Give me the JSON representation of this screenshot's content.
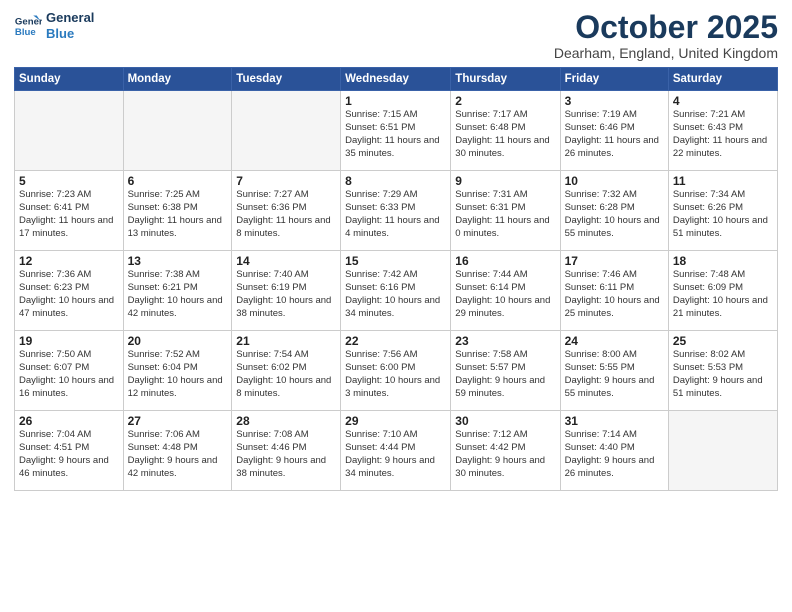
{
  "logo": {
    "line1": "General",
    "line2": "Blue"
  },
  "title": "October 2025",
  "location": "Dearham, England, United Kingdom",
  "weekdays": [
    "Sunday",
    "Monday",
    "Tuesday",
    "Wednesday",
    "Thursday",
    "Friday",
    "Saturday"
  ],
  "weeks": [
    [
      {
        "day": "",
        "info": ""
      },
      {
        "day": "",
        "info": ""
      },
      {
        "day": "",
        "info": ""
      },
      {
        "day": "1",
        "info": "Sunrise: 7:15 AM\nSunset: 6:51 PM\nDaylight: 11 hours\nand 35 minutes."
      },
      {
        "day": "2",
        "info": "Sunrise: 7:17 AM\nSunset: 6:48 PM\nDaylight: 11 hours\nand 30 minutes."
      },
      {
        "day": "3",
        "info": "Sunrise: 7:19 AM\nSunset: 6:46 PM\nDaylight: 11 hours\nand 26 minutes."
      },
      {
        "day": "4",
        "info": "Sunrise: 7:21 AM\nSunset: 6:43 PM\nDaylight: 11 hours\nand 22 minutes."
      }
    ],
    [
      {
        "day": "5",
        "info": "Sunrise: 7:23 AM\nSunset: 6:41 PM\nDaylight: 11 hours\nand 17 minutes."
      },
      {
        "day": "6",
        "info": "Sunrise: 7:25 AM\nSunset: 6:38 PM\nDaylight: 11 hours\nand 13 minutes."
      },
      {
        "day": "7",
        "info": "Sunrise: 7:27 AM\nSunset: 6:36 PM\nDaylight: 11 hours\nand 8 minutes."
      },
      {
        "day": "8",
        "info": "Sunrise: 7:29 AM\nSunset: 6:33 PM\nDaylight: 11 hours\nand 4 minutes."
      },
      {
        "day": "9",
        "info": "Sunrise: 7:31 AM\nSunset: 6:31 PM\nDaylight: 11 hours\nand 0 minutes."
      },
      {
        "day": "10",
        "info": "Sunrise: 7:32 AM\nSunset: 6:28 PM\nDaylight: 10 hours\nand 55 minutes."
      },
      {
        "day": "11",
        "info": "Sunrise: 7:34 AM\nSunset: 6:26 PM\nDaylight: 10 hours\nand 51 minutes."
      }
    ],
    [
      {
        "day": "12",
        "info": "Sunrise: 7:36 AM\nSunset: 6:23 PM\nDaylight: 10 hours\nand 47 minutes."
      },
      {
        "day": "13",
        "info": "Sunrise: 7:38 AM\nSunset: 6:21 PM\nDaylight: 10 hours\nand 42 minutes."
      },
      {
        "day": "14",
        "info": "Sunrise: 7:40 AM\nSunset: 6:19 PM\nDaylight: 10 hours\nand 38 minutes."
      },
      {
        "day": "15",
        "info": "Sunrise: 7:42 AM\nSunset: 6:16 PM\nDaylight: 10 hours\nand 34 minutes."
      },
      {
        "day": "16",
        "info": "Sunrise: 7:44 AM\nSunset: 6:14 PM\nDaylight: 10 hours\nand 29 minutes."
      },
      {
        "day": "17",
        "info": "Sunrise: 7:46 AM\nSunset: 6:11 PM\nDaylight: 10 hours\nand 25 minutes."
      },
      {
        "day": "18",
        "info": "Sunrise: 7:48 AM\nSunset: 6:09 PM\nDaylight: 10 hours\nand 21 minutes."
      }
    ],
    [
      {
        "day": "19",
        "info": "Sunrise: 7:50 AM\nSunset: 6:07 PM\nDaylight: 10 hours\nand 16 minutes."
      },
      {
        "day": "20",
        "info": "Sunrise: 7:52 AM\nSunset: 6:04 PM\nDaylight: 10 hours\nand 12 minutes."
      },
      {
        "day": "21",
        "info": "Sunrise: 7:54 AM\nSunset: 6:02 PM\nDaylight: 10 hours\nand 8 minutes."
      },
      {
        "day": "22",
        "info": "Sunrise: 7:56 AM\nSunset: 6:00 PM\nDaylight: 10 hours\nand 3 minutes."
      },
      {
        "day": "23",
        "info": "Sunrise: 7:58 AM\nSunset: 5:57 PM\nDaylight: 9 hours\nand 59 minutes."
      },
      {
        "day": "24",
        "info": "Sunrise: 8:00 AM\nSunset: 5:55 PM\nDaylight: 9 hours\nand 55 minutes."
      },
      {
        "day": "25",
        "info": "Sunrise: 8:02 AM\nSunset: 5:53 PM\nDaylight: 9 hours\nand 51 minutes."
      }
    ],
    [
      {
        "day": "26",
        "info": "Sunrise: 7:04 AM\nSunset: 4:51 PM\nDaylight: 9 hours\nand 46 minutes."
      },
      {
        "day": "27",
        "info": "Sunrise: 7:06 AM\nSunset: 4:48 PM\nDaylight: 9 hours\nand 42 minutes."
      },
      {
        "day": "28",
        "info": "Sunrise: 7:08 AM\nSunset: 4:46 PM\nDaylight: 9 hours\nand 38 minutes."
      },
      {
        "day": "29",
        "info": "Sunrise: 7:10 AM\nSunset: 4:44 PM\nDaylight: 9 hours\nand 34 minutes."
      },
      {
        "day": "30",
        "info": "Sunrise: 7:12 AM\nSunset: 4:42 PM\nDaylight: 9 hours\nand 30 minutes."
      },
      {
        "day": "31",
        "info": "Sunrise: 7:14 AM\nSunset: 4:40 PM\nDaylight: 9 hours\nand 26 minutes."
      },
      {
        "day": "",
        "info": ""
      }
    ]
  ]
}
